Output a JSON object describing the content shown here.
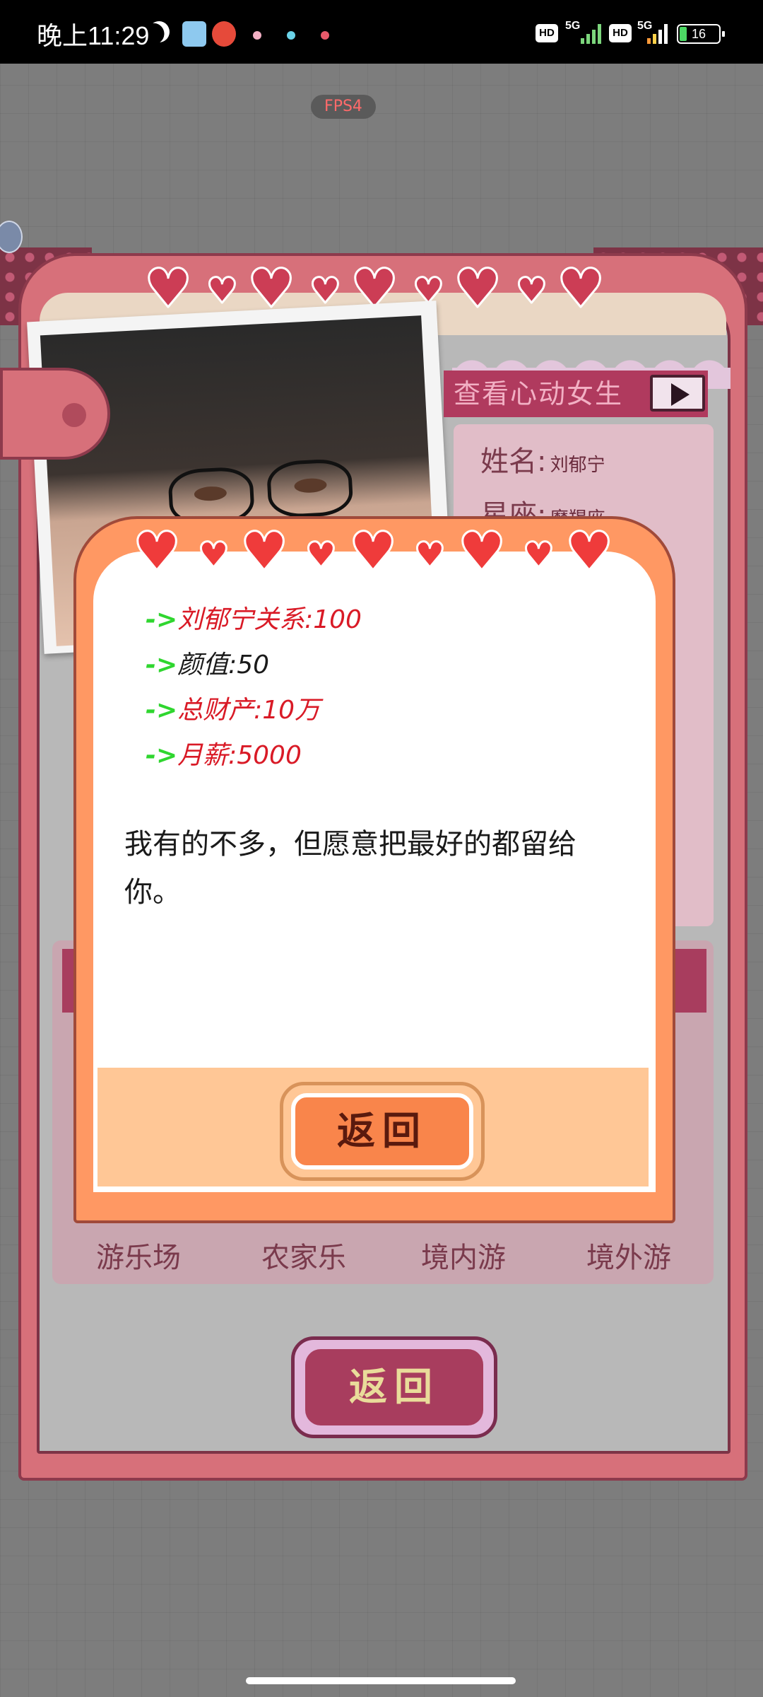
{
  "status_bar": {
    "time": "晚上11:29",
    "battery": "16",
    "network_1": "5G",
    "network_2": "5G",
    "hd_1": "HD",
    "hd_2": "HD"
  },
  "fps": "FPS4",
  "profile_card": {
    "banner": "查看心动女生",
    "name_label": "姓名",
    "name_value": "刘郁宁",
    "sign_label": "星座",
    "sign_value": "摩羯座",
    "destinations": [
      "游乐场",
      "农家乐",
      "境内游",
      "境外游"
    ],
    "back_button": "返回"
  },
  "dialog": {
    "stats": [
      {
        "arrow": "->",
        "label": "刘郁宁关系:",
        "value": "100",
        "color": "red"
      },
      {
        "arrow": "->",
        "label": "颜值:",
        "value": "50",
        "color": "black"
      },
      {
        "arrow": "->",
        "label": "总财产:",
        "value": "10万",
        "color": "red"
      },
      {
        "arrow": "->",
        "label": "月薪:",
        "value": "5000",
        "color": "red"
      }
    ],
    "quote": "我有的不多，但愿意把最好的都留给你。",
    "return_button": "返回"
  },
  "colors": {
    "dialog_orange": "#ff9863",
    "card_pink": "#d7707a",
    "heart_red": "#cc3d55",
    "arrow_green": "#2fd62f"
  }
}
